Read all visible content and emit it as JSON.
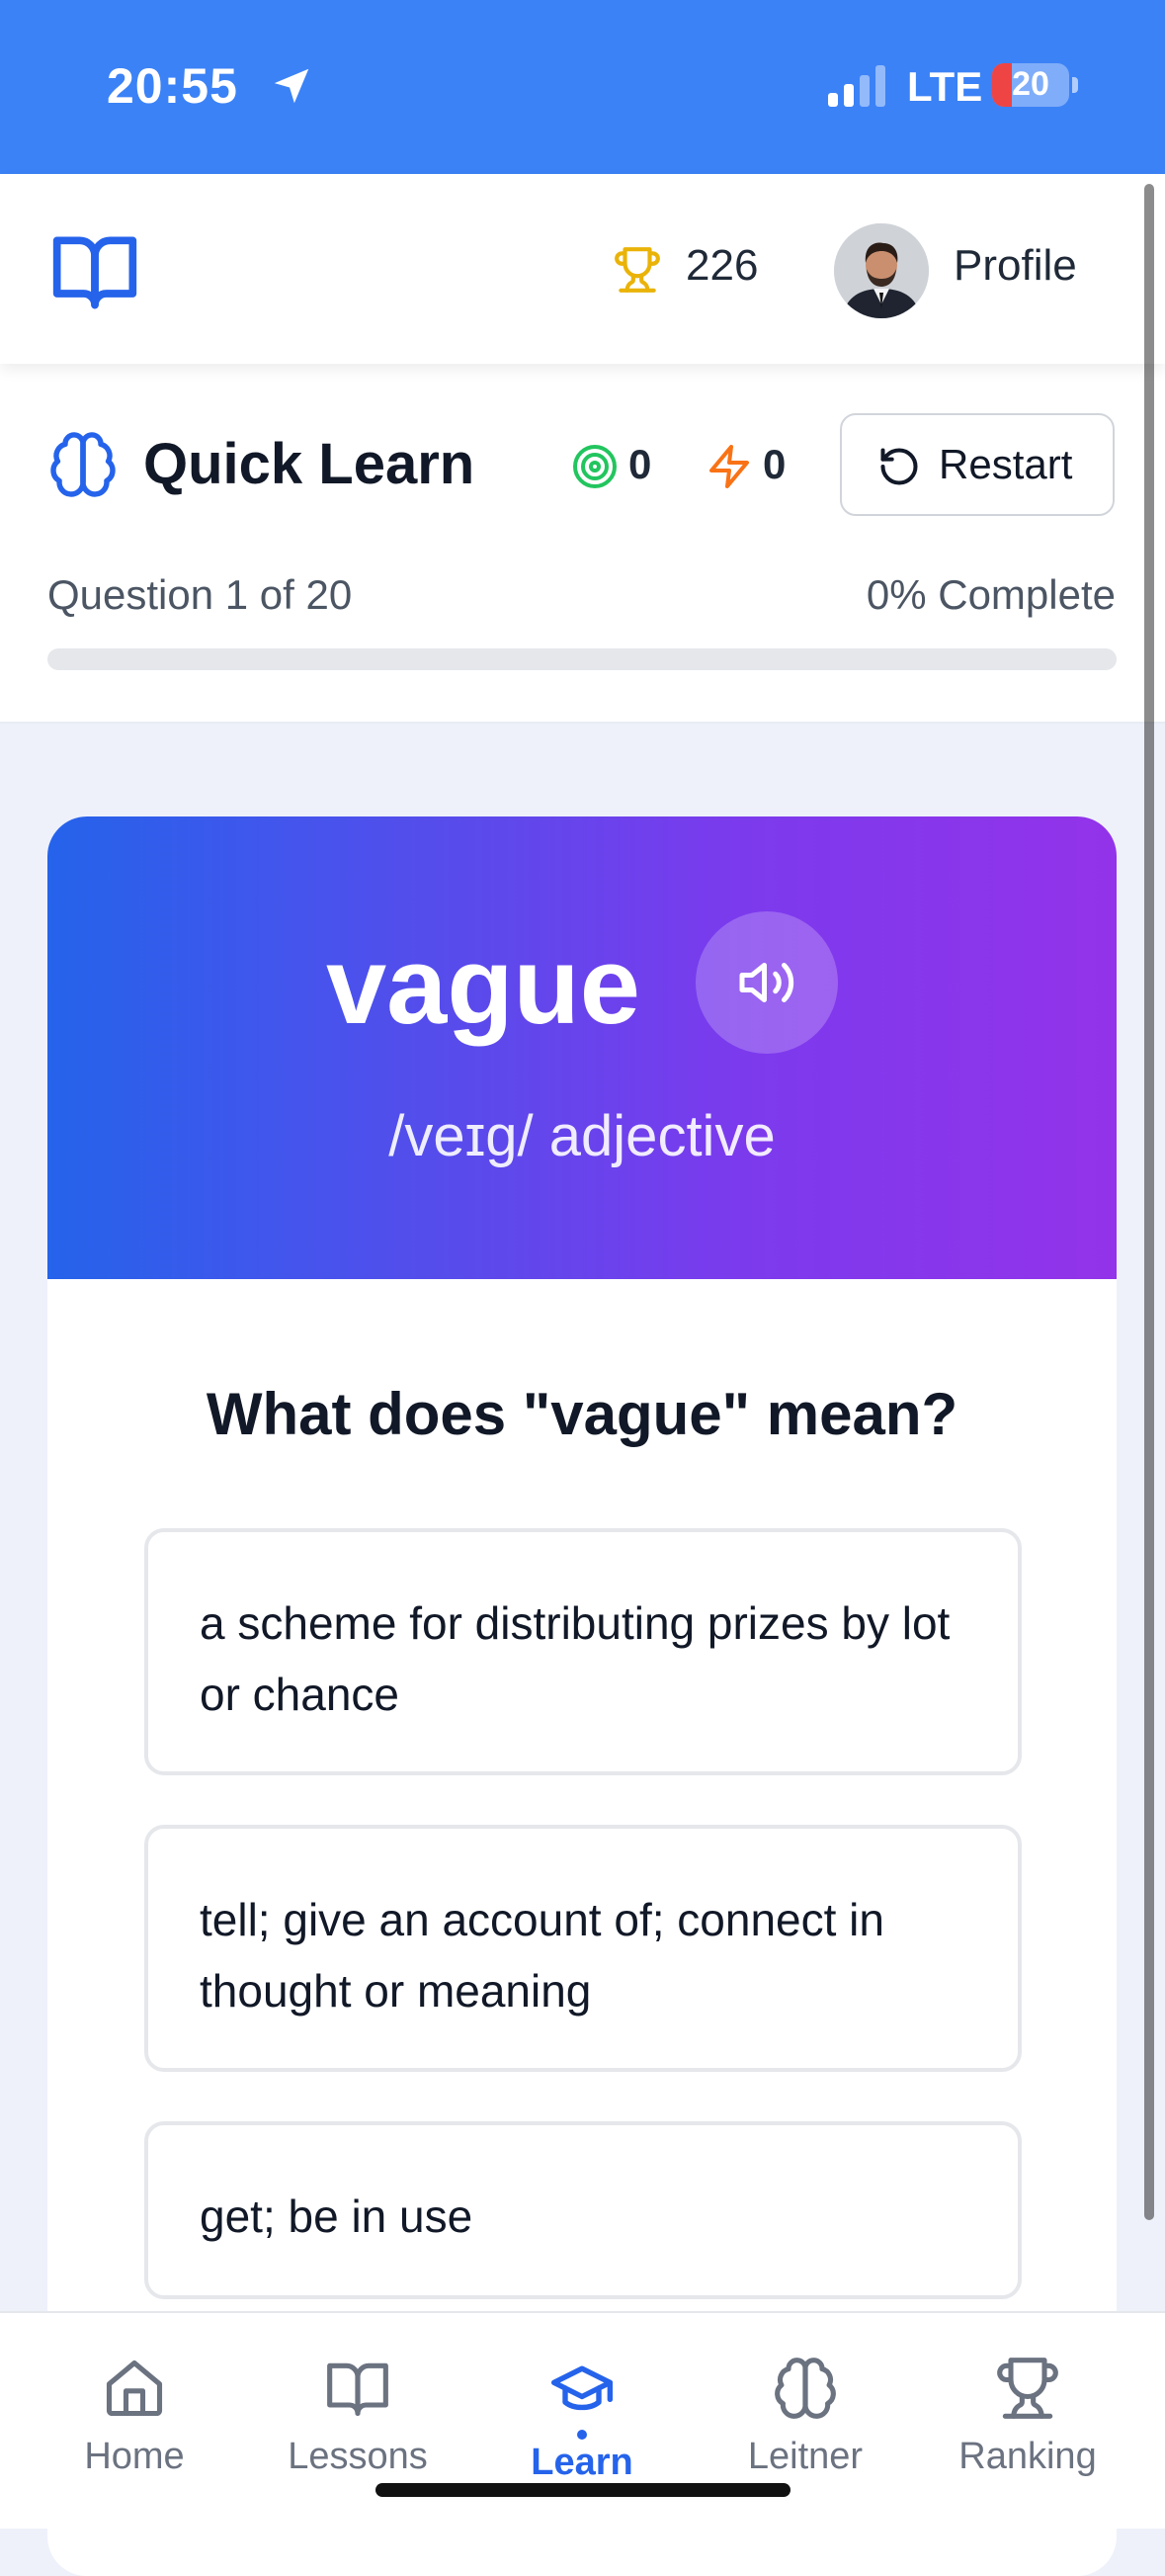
{
  "status_bar": {
    "time": "20:55",
    "network": "LTE",
    "battery": "20"
  },
  "header": {
    "points": "226",
    "profile_label": "Profile"
  },
  "quick_learn": {
    "title": "Quick Learn",
    "correct_count": "0",
    "streak_count": "0",
    "restart_label": "Restart",
    "question_progress": "Question 1 of 20",
    "complete_label": "0% Complete",
    "progress_fraction": 0
  },
  "card": {
    "word": "vague",
    "pronunciation": "/veɪg/ adjective",
    "question": "What does \"vague\" mean?",
    "options": [
      "a scheme for distributing prizes by lot or chance",
      "tell; give an account of; connect in thought or meaning",
      "get; be in use"
    ]
  },
  "nav": {
    "items": [
      {
        "label": "Home",
        "icon": "home-icon"
      },
      {
        "label": "Lessons",
        "icon": "book-icon"
      },
      {
        "label": "Learn",
        "icon": "graduation-cap-icon",
        "active": true
      },
      {
        "label": "Leitner",
        "icon": "brain-icon"
      },
      {
        "label": "Ranking",
        "icon": "trophy-icon"
      }
    ]
  },
  "colors": {
    "primary": "#3b82f6",
    "accent_purple": "#9333ea",
    "trophy": "#eab308",
    "target": "#22c55e",
    "bolt": "#f97316"
  }
}
